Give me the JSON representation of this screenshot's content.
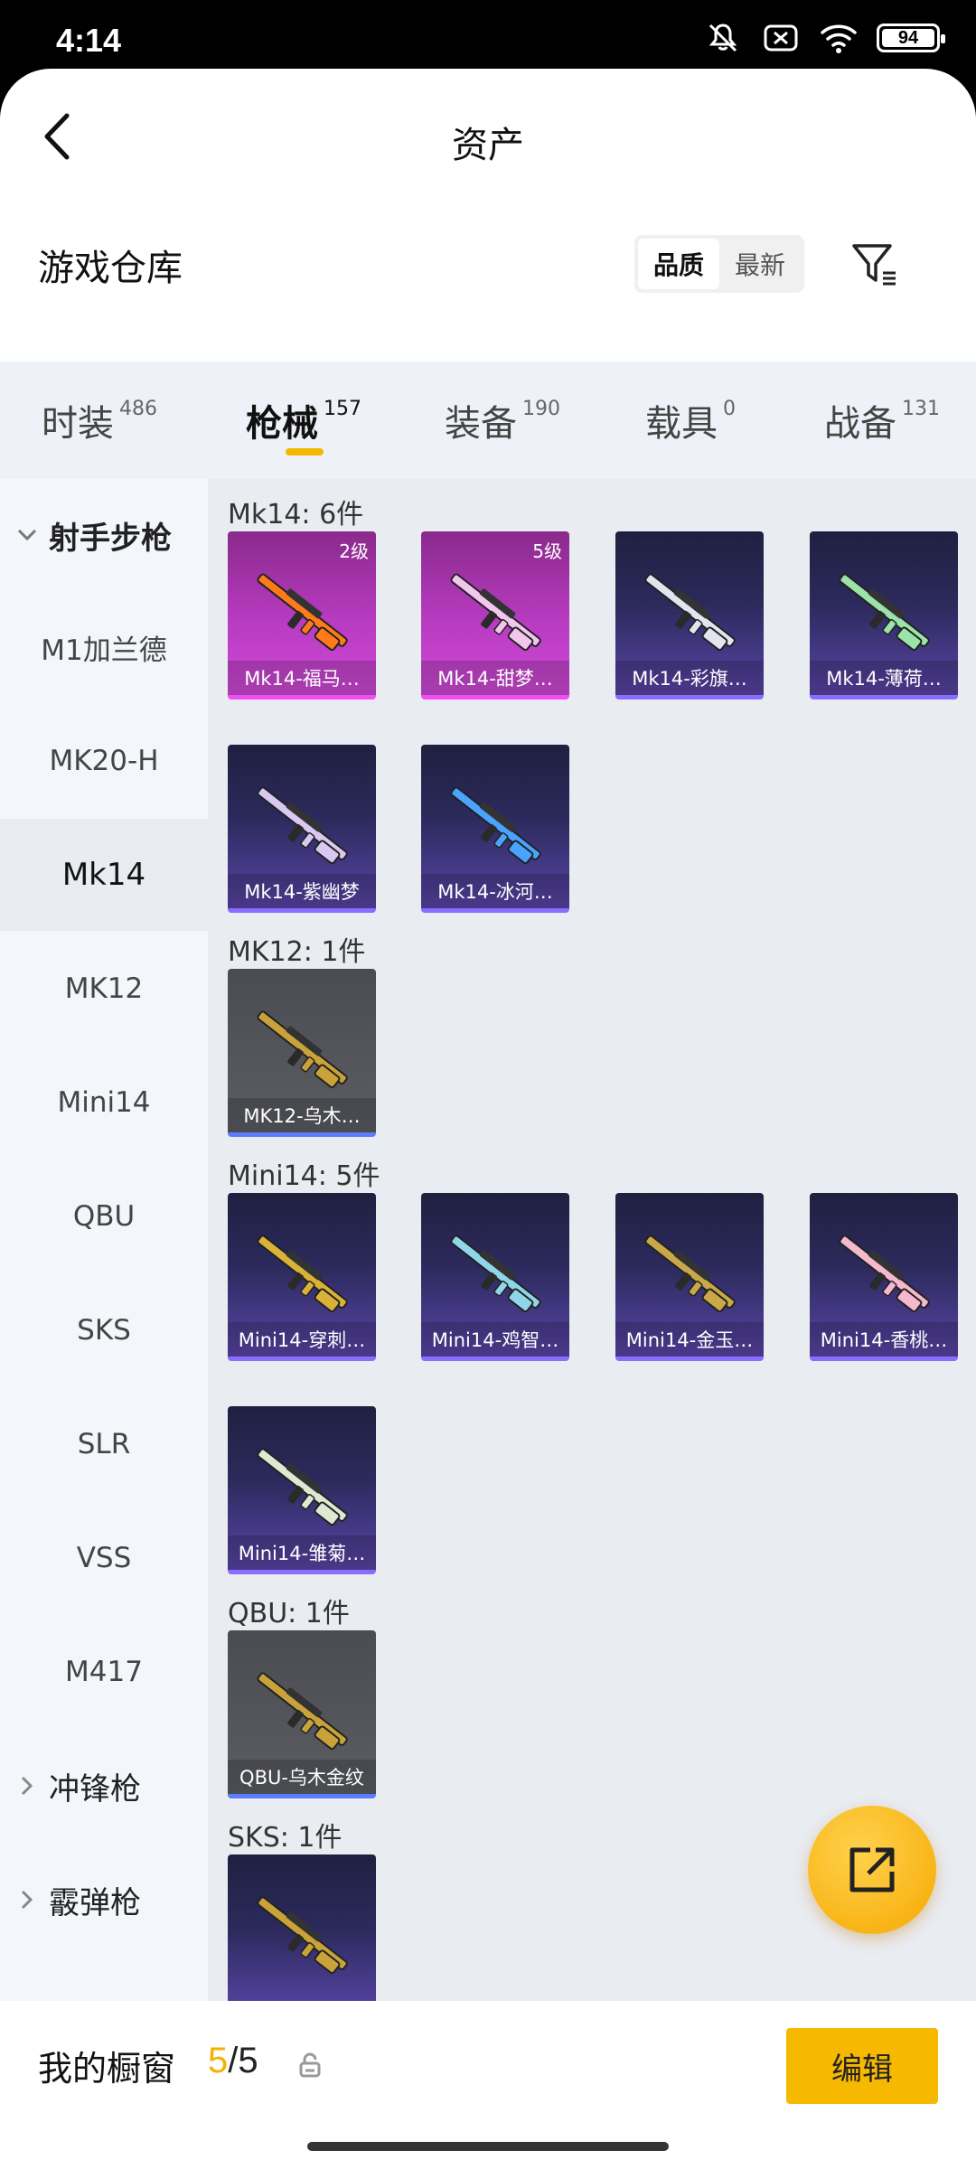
{
  "status_bar": {
    "time": "4:14",
    "battery": "94",
    "battery_level": 0.94
  },
  "nav": {
    "title": "资产"
  },
  "warehouse": {
    "title": "游戏仓库",
    "sort_options": [
      "品质",
      "最新"
    ],
    "active_sort": 0
  },
  "tabs": [
    {
      "label": "时装",
      "count": "486"
    },
    {
      "label": "枪械",
      "count": "157"
    },
    {
      "label": "装备",
      "count": "190"
    },
    {
      "label": "载具",
      "count": "0"
    },
    {
      "label": "战备",
      "count": "131"
    }
  ],
  "sidebar": {
    "group_open": "射手步枪",
    "items": [
      "M1加兰德",
      "MK20-H",
      "Mk14",
      "MK12",
      "Mini14",
      "QBU",
      "SKS",
      "SLR",
      "VSS",
      "M417"
    ],
    "active_item": "Mk14",
    "collapsed_groups": [
      "冲锋枪",
      "霰弹枪"
    ]
  },
  "groups": [
    {
      "title": "Mk14: 6件",
      "items": [
        {
          "name": "Mk14-福马…",
          "level": "2级",
          "style": "magenta",
          "color": "#ff7a18"
        },
        {
          "name": "Mk14-甜梦…",
          "level": "5级",
          "style": "magenta",
          "color": "#f3c6ee"
        },
        {
          "name": "Mk14-彩旗…",
          "level": "",
          "style": "purple",
          "color": "#e2e4f0"
        },
        {
          "name": "Mk14-薄荷…",
          "level": "",
          "style": "purple",
          "color": "#9be3a8"
        },
        {
          "name": "Mk14-紫幽梦",
          "level": "",
          "style": "purple",
          "color": "#d9c8f2"
        },
        {
          "name": "Mk14-冰河…",
          "level": "",
          "style": "purple",
          "color": "#4aa3ff"
        }
      ]
    },
    {
      "title": "MK12: 1件",
      "items": [
        {
          "name": "MK12-乌木…",
          "level": "",
          "style": "gray",
          "color": "#c9a23a"
        }
      ]
    },
    {
      "title": "Mini14: 5件",
      "items": [
        {
          "name": "Mini14-穿刺…",
          "level": "",
          "style": "purple",
          "color": "#d9b23a"
        },
        {
          "name": "Mini14-鸡智…",
          "level": "",
          "style": "purple",
          "color": "#8fd6e8"
        },
        {
          "name": "Mini14-金玉…",
          "level": "",
          "style": "purple",
          "color": "#c8a848"
        },
        {
          "name": "Mini14-香桃…",
          "level": "",
          "style": "purple",
          "color": "#f5b8cc"
        },
        {
          "name": "Mini14-雏菊…",
          "level": "",
          "style": "purple",
          "color": "#dfe8d2"
        }
      ]
    },
    {
      "title": "QBU: 1件",
      "items": [
        {
          "name": "QBU-乌木金纹",
          "level": "",
          "style": "gray",
          "color": "#c9a23a"
        }
      ]
    },
    {
      "title": "SKS: 1件",
      "items": [
        {
          "name": "",
          "level": "",
          "style": "purple",
          "color": "#c9a23a"
        }
      ]
    }
  ],
  "showcase": {
    "label": "我的橱窗",
    "current": "5",
    "separator": "/",
    "max": "5",
    "edit_label": "编辑"
  },
  "icons": [
    "back-arrow-icon",
    "filter-icon",
    "share-out-icon",
    "lock-icon",
    "mute-icon",
    "sim-off-icon",
    "wifi-icon",
    "battery-icon"
  ]
}
